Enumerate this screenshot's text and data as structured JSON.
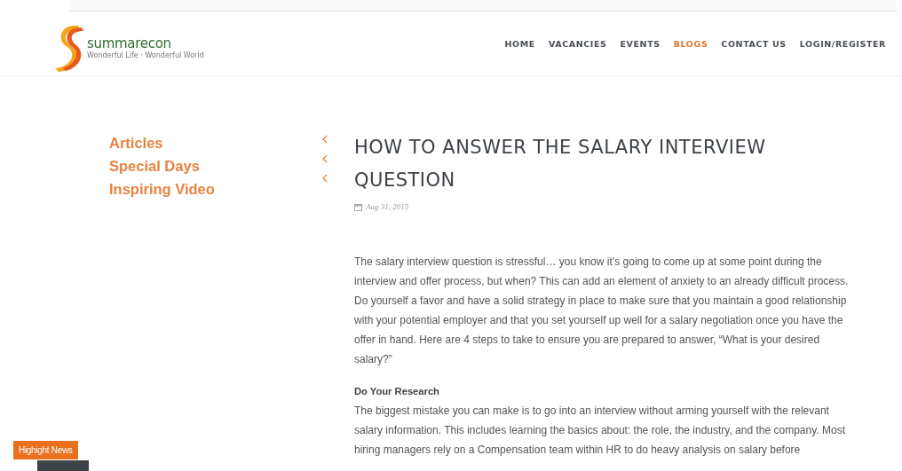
{
  "logo": {
    "name": "summarecon",
    "tagline": "Wonderful Life · Wonderful World"
  },
  "nav": [
    {
      "label": "HOME",
      "selected": false
    },
    {
      "label": "VACANCIES",
      "selected": false
    },
    {
      "label": "EVENTS",
      "selected": false
    },
    {
      "label": "BLOGS",
      "selected": true
    },
    {
      "label": "CONTACT US",
      "selected": false
    },
    {
      "label": "LOGIN/REGISTER",
      "selected": false
    }
  ],
  "categories": [
    "Articles",
    "Special Days",
    "Inspiring Video"
  ],
  "article": {
    "title": "HOW TO ANSWER THE SALARY INTERVIEW QUESTION",
    "date": "Aug 31, 2015",
    "intro": "The salary interview question is stressful… you know it’s going to come up at some point during the interview and offer process, but when? This can add an element of anxiety to an already difficult process. Do yourself a favor and have a solid strategy in place to make sure that you maintain a good relationship with your potential employer and that you set yourself up well for a salary negotiation once you have the offer in hand. Here are 4 steps to take to ensure you are prepared to answer, “What is your desired salary?”",
    "section_heading": "Do Your Research",
    "section_body": "The biggest mistake you can make is to go into an interview without arming yourself with the relevant salary information. This includes learning the basics about: the role, the industry, and the company. Most hiring managers rely on a Compensation team within HR to do heavy analysis on salary before"
  },
  "highlight": {
    "label": "Highight News"
  }
}
